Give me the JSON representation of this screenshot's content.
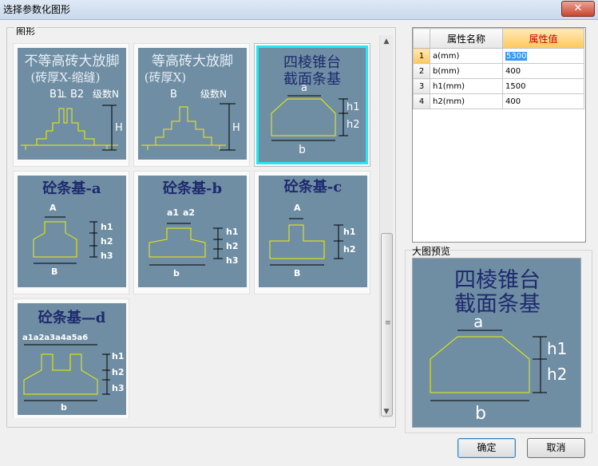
{
  "window": {
    "title": "选择参数化图形",
    "close_label": "✕"
  },
  "gallery": {
    "group_label": "图形",
    "items": [
      {
        "title1": "不等高砖大放脚",
        "title2": "(砖厚X-缩缝)",
        "labels": [
          "B1",
          "L",
          "B2",
          "级数N",
          "H"
        ]
      },
      {
        "title1": "等高砖大放脚",
        "title2": "(砖厚X)",
        "labels": [
          "B",
          "级数N",
          "H"
        ]
      },
      {
        "title1": "四棱锥台",
        "title2": "截面条基",
        "labels": [
          "a",
          "h1",
          "h2",
          "b"
        ],
        "selected": true
      },
      {
        "title1": "砼条基-a",
        "labels": [
          "A",
          "h1",
          "h2",
          "h3",
          "B"
        ]
      },
      {
        "title1": "砼条基-b",
        "labels": [
          "a1",
          "a2",
          "h1",
          "h2",
          "h3",
          "b"
        ]
      },
      {
        "title1": "砼条基-c",
        "labels": [
          "A",
          "h1",
          "h2",
          "B"
        ]
      },
      {
        "title1": "砼条基—d",
        "labels": [
          "a1a2a3a4a5a6",
          "h1",
          "h2",
          "h3",
          "b"
        ]
      }
    ]
  },
  "props": {
    "col_name": "属性名称",
    "col_value": "属性值",
    "rows": [
      {
        "idx": "1",
        "name": "a(mm)",
        "value": "5300",
        "editing": true
      },
      {
        "idx": "2",
        "name": "b(mm)",
        "value": "400"
      },
      {
        "idx": "3",
        "name": "h1(mm)",
        "value": "1500"
      },
      {
        "idx": "4",
        "name": "h2(mm)",
        "value": "400"
      }
    ]
  },
  "preview": {
    "label": "大图预览",
    "title1": "四棱锥台",
    "title2": "截面条基",
    "labels": [
      "a",
      "h1",
      "h2",
      "b"
    ]
  },
  "buttons": {
    "ok": "确定",
    "cancel": "取消"
  },
  "colors": {
    "thumb_bg": "#6f8ea3",
    "selection": "#27e6ee",
    "title_dark": "#1e2a6e",
    "outline": "#f0f000"
  }
}
